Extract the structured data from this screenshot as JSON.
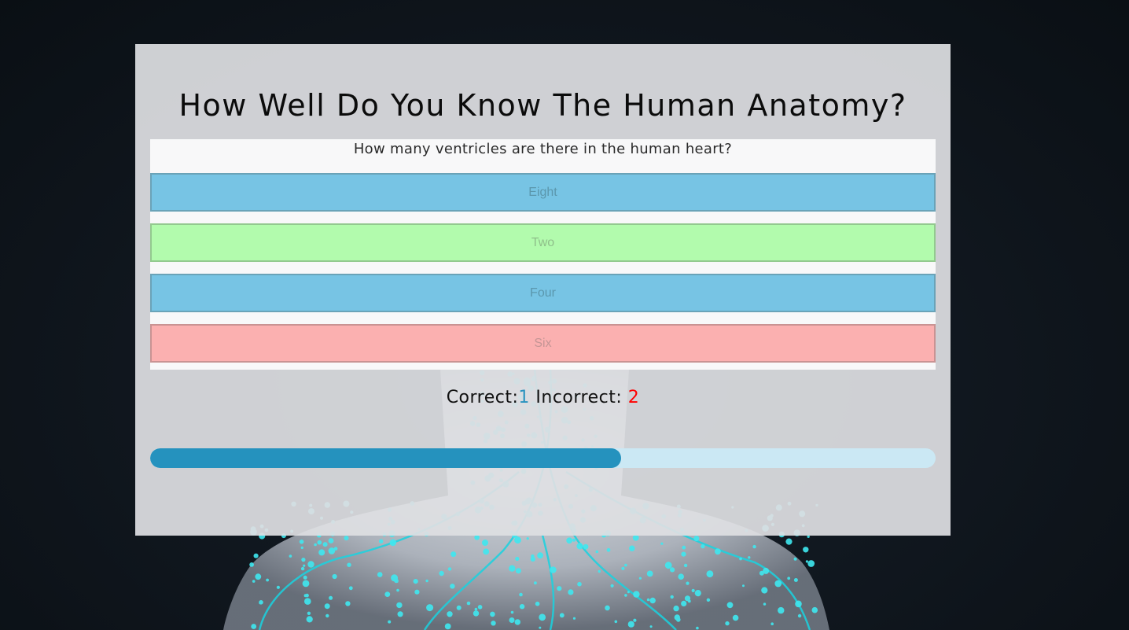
{
  "quiz": {
    "title": "How Well Do You Know The Human Anatomy?",
    "question": "How many ventricles are there in the human heart?",
    "answers": [
      {
        "label": "Eight",
        "state": "neutral"
      },
      {
        "label": "Two",
        "state": "correct"
      },
      {
        "label": "Four",
        "state": "neutral"
      },
      {
        "label": "Six",
        "state": "incorrect"
      }
    ]
  },
  "score": {
    "correct_label": "Correct:",
    "correct_value": "1",
    "incorrect_label": "Incorrect:",
    "incorrect_value": "2"
  },
  "progress": {
    "fraction": 0.6
  },
  "colors": {
    "neutral_fill": "#77c4e4",
    "neutral_border": "#6aa3b8",
    "neutral_text": "#5b97ad",
    "correct_fill": "#b2fbad",
    "correct_border": "#93c98f",
    "correct_text": "#8fbf8a",
    "incorrect_fill": "#fbb0b0",
    "incorrect_border": "#c99393",
    "incorrect_text": "#c49595",
    "correct_count": "#2a93bf",
    "incorrect_count": "#ff0000",
    "progress_fill": "#2592be",
    "progress_track": "#cbe8f4"
  },
  "background": {
    "icon": "human-anatomy-figure"
  }
}
